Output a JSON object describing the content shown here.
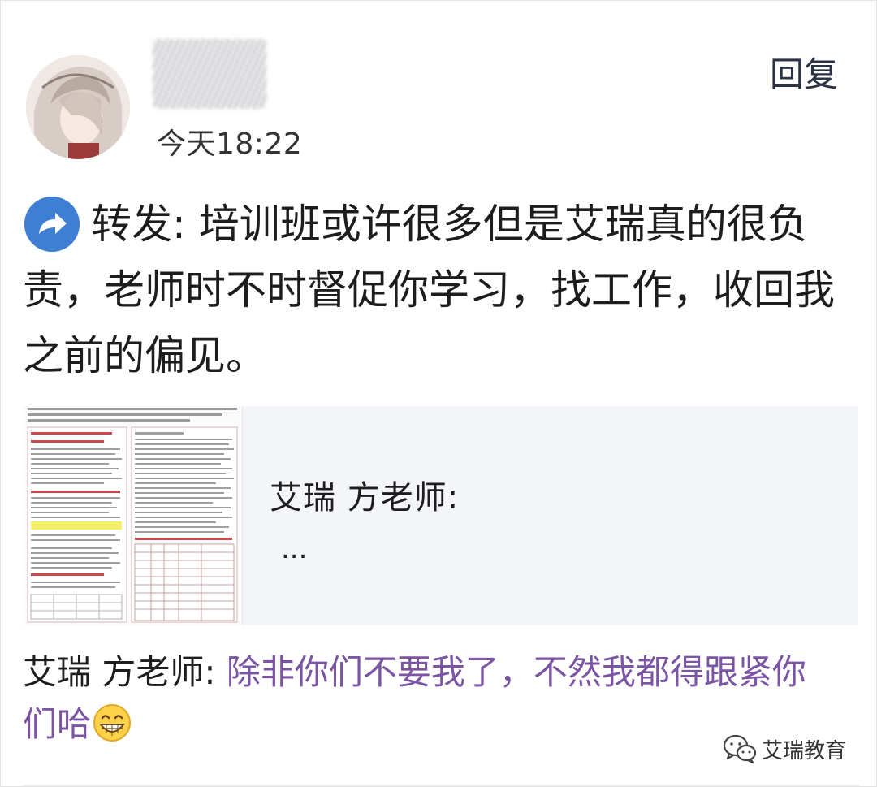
{
  "header": {
    "timestamp": "今天18:22",
    "reply_label": "回复"
  },
  "post": {
    "forward_icon": "forward-arrow-icon",
    "text": "转发: 培训班或许很多但是艾瑞真的很负责，老师时不时督促你学习，找工作，收回我之前的偏见。"
  },
  "quote": {
    "author": "艾瑞 方老师:",
    "excerpt": "..."
  },
  "reply": {
    "author": "艾瑞 方老师: ",
    "content": "除非你们不要我了，不然我都得跟紧你们哈",
    "emoji": "grin-emoji"
  },
  "watermark": {
    "icon": "wechat-icon",
    "text": "艾瑞教育"
  },
  "colors": {
    "accent_forward": "#3f7fd3",
    "reply_text": "#7b55a3",
    "card_bg": "#f3f5f9"
  }
}
